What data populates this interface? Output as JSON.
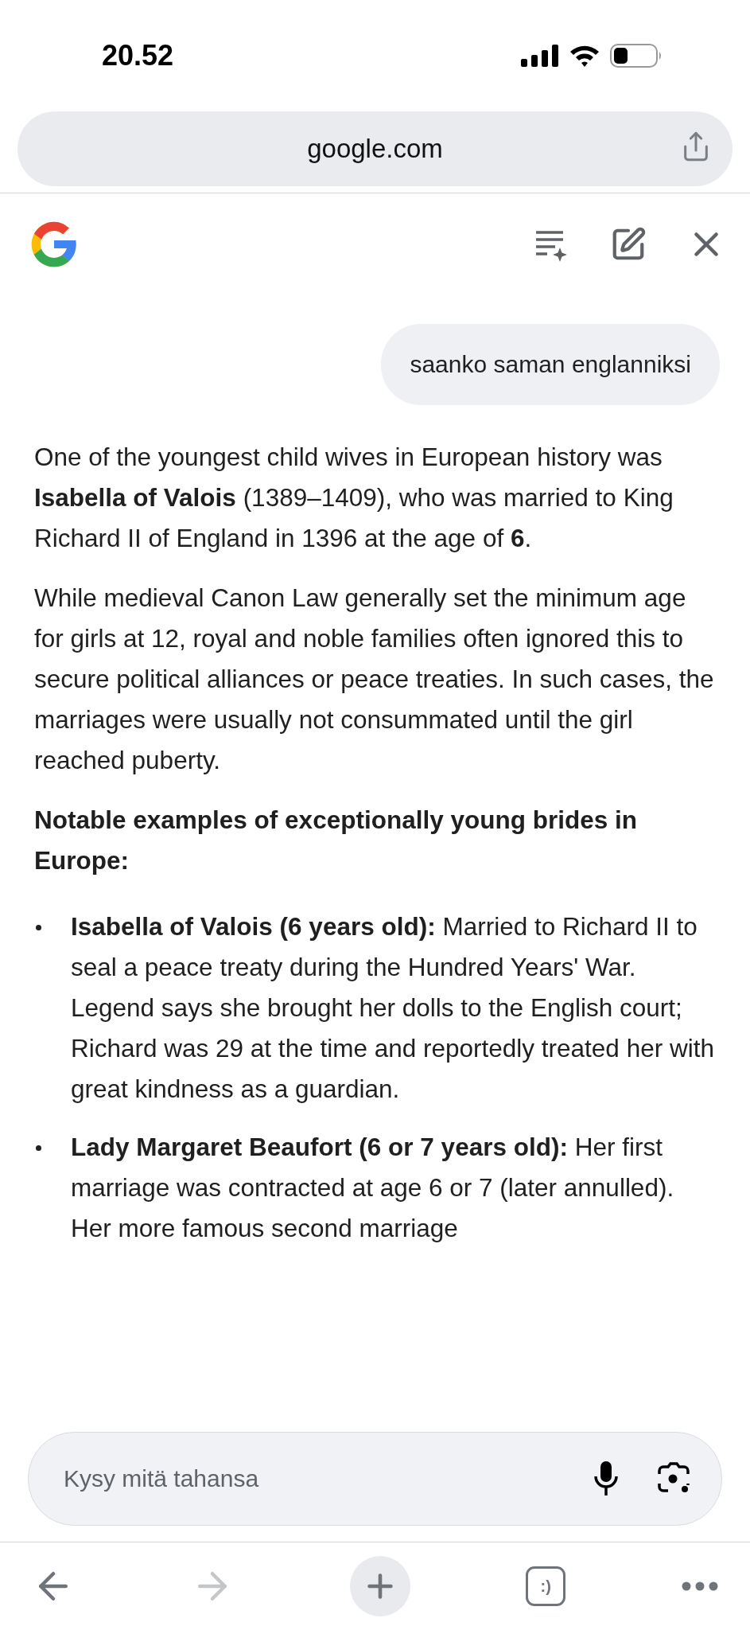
{
  "status_bar": {
    "time": "20.52"
  },
  "address_bar": {
    "url": "google.com"
  },
  "chat": {
    "messages": [
      {
        "kind": "user",
        "text": "saanko saman englanniksi"
      }
    ],
    "paragraphs": [
      "One of the youngest child wives in European history was **Isabella of Valois** (1389–1409), who was married to King Richard II of England in 1396 at the age of **6**.",
      "While medieval Canon Law generally set the minimum age for girls at 12, royal and noble families often ignored this to secure political alliances or peace treaties. In such cases, the marriages were usually not consummated until the girl reached puberty."
    ],
    "heading": "Notable examples of exceptionally young brides in Europe:",
    "bullets": [
      "**Isabella of Valois (6 years old):** Married to Richard II to seal a peace treaty during the Hundred Years' War. Legend says she brought her dolls to the English court; Richard was 29 at the time and reportedly treated her with great kindness as a guardian.",
      "**Lady Margaret Beaufort (6 or 7 years old):** Her first marriage was contracted at age 6 or 7 (later annulled). Her more famous second marriage"
    ]
  },
  "input": {
    "placeholder": "Kysy mitä tahansa"
  },
  "nav": [
    {
      "kind": "back",
      "disabled": false
    },
    {
      "kind": "forward",
      "disabled": true
    },
    {
      "kind": "new-tab",
      "disabled": false
    },
    {
      "kind": "tabs",
      "disabled": false,
      "label": ":)"
    },
    {
      "kind": "more",
      "disabled": false
    }
  ]
}
